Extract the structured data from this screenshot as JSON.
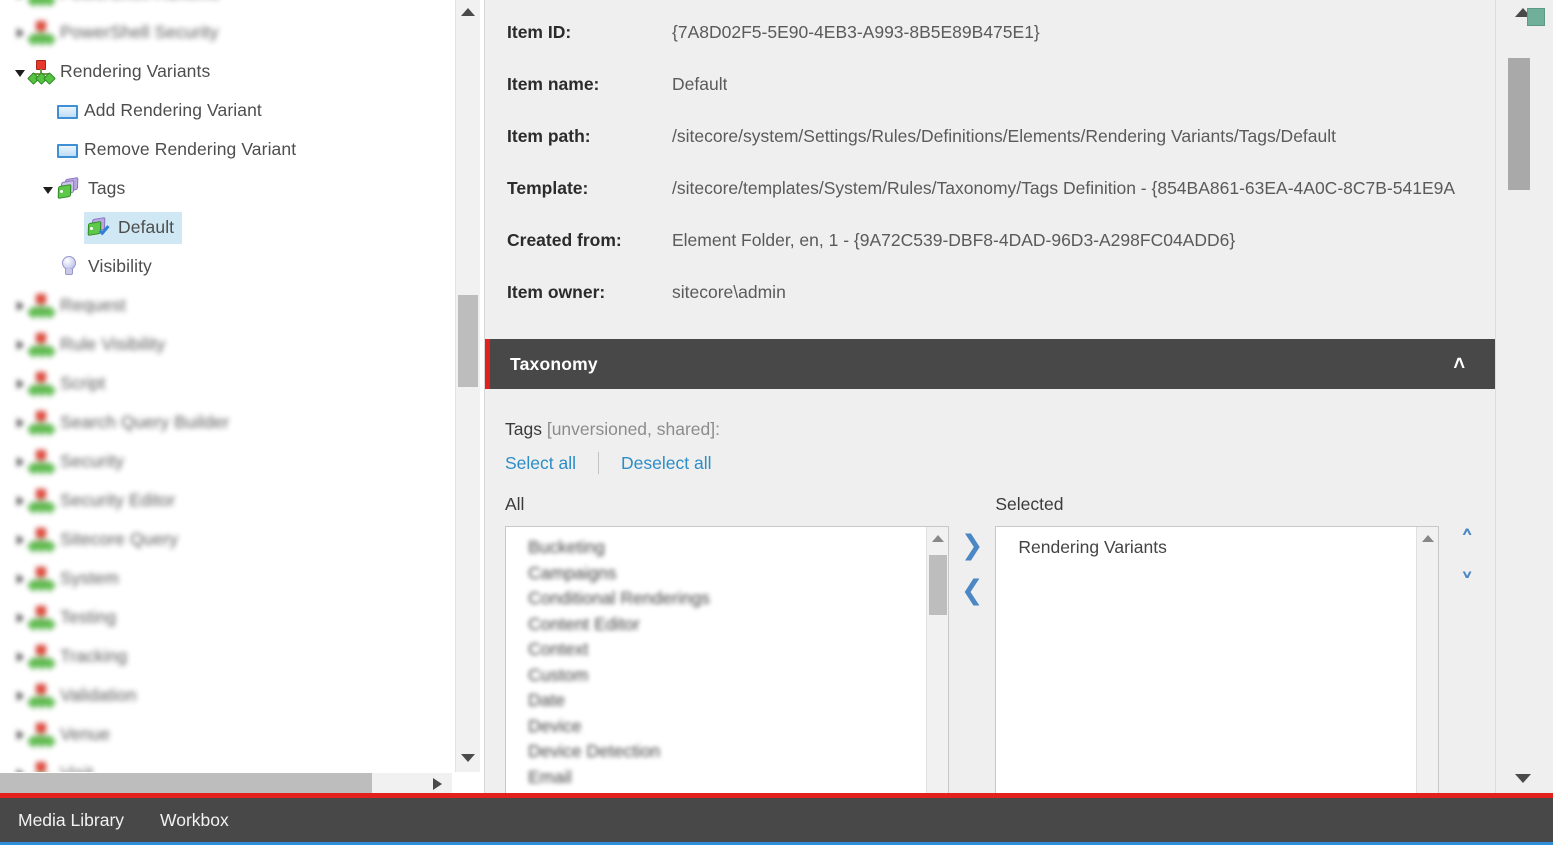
{
  "tree": {
    "items": [
      {
        "label": "PowerShell Runtime",
        "icon": "rules-element-icon",
        "indent": 0,
        "expander": "collapsed",
        "blurred": true,
        "clipped": true
      },
      {
        "label": "PowerShell Security",
        "icon": "rules-element-icon",
        "indent": 0,
        "expander": "collapsed",
        "blurred": true
      },
      {
        "label": "Rendering Variants",
        "icon": "rules-element-icon",
        "indent": 0,
        "expander": "expanded",
        "blurred": false
      },
      {
        "label": "Add Rendering Variant",
        "icon": "blue-rectangle-icon",
        "indent": 1,
        "expander": "none",
        "blurred": false
      },
      {
        "label": "Remove Rendering Variant",
        "icon": "blue-rectangle-icon",
        "indent": 1,
        "expander": "none",
        "blurred": false
      },
      {
        "label": "Tags",
        "icon": "tags-icon",
        "indent": 1,
        "expander": "expanded",
        "blurred": false
      },
      {
        "label": "Default",
        "icon": "tag-check-icon",
        "indent": 2,
        "expander": "none",
        "blurred": false,
        "selected": true
      },
      {
        "label": "Visibility",
        "icon": "lightbulb-icon",
        "indent": 1,
        "expander": "none",
        "blurred": false
      },
      {
        "label": "Request",
        "icon": "rules-element-icon",
        "indent": 0,
        "expander": "collapsed",
        "blurred": true
      },
      {
        "label": "Rule Visibility",
        "icon": "rules-element-icon",
        "indent": 0,
        "expander": "collapsed",
        "blurred": true
      },
      {
        "label": "Script",
        "icon": "rules-element-icon",
        "indent": 0,
        "expander": "collapsed",
        "blurred": true
      },
      {
        "label": "Search Query Builder",
        "icon": "rules-element-icon",
        "indent": 0,
        "expander": "collapsed",
        "blurred": true
      },
      {
        "label": "Security",
        "icon": "rules-element-icon",
        "indent": 0,
        "expander": "collapsed",
        "blurred": true
      },
      {
        "label": "Security Editor",
        "icon": "rules-element-icon",
        "indent": 0,
        "expander": "collapsed",
        "blurred": true
      },
      {
        "label": "Sitecore Query",
        "icon": "rules-element-icon",
        "indent": 0,
        "expander": "collapsed",
        "blurred": true
      },
      {
        "label": "System",
        "icon": "rules-element-icon",
        "indent": 0,
        "expander": "collapsed",
        "blurred": true
      },
      {
        "label": "Testing",
        "icon": "rules-element-icon",
        "indent": 0,
        "expander": "collapsed",
        "blurred": true
      },
      {
        "label": "Tracking",
        "icon": "rules-element-icon",
        "indent": 0,
        "expander": "collapsed",
        "blurred": true
      },
      {
        "label": "Validation",
        "icon": "rules-element-icon",
        "indent": 0,
        "expander": "collapsed",
        "blurred": true
      },
      {
        "label": "Venue",
        "icon": "rules-element-icon",
        "indent": 0,
        "expander": "collapsed",
        "blurred": true
      },
      {
        "label": "Visit",
        "icon": "rules-element-icon",
        "indent": 0,
        "expander": "collapsed",
        "blurred": true,
        "clipped": true
      }
    ]
  },
  "item_info": {
    "rows": [
      {
        "label": "Item ID:",
        "value": "{7A8D02F5-5E90-4EB3-A993-8B5E89B475E1}"
      },
      {
        "label": "Item name:",
        "value": "Default"
      },
      {
        "label": "Item path:",
        "value": "/sitecore/system/Settings/Rules/Definitions/Elements/Rendering Variants/Tags/Default"
      },
      {
        "label": "Template:",
        "value": "/sitecore/templates/System/Rules/Taxonomy/Tags Definition - {854BA861-63EA-4A0C-8C7B-541E9A"
      },
      {
        "label": "Created from:",
        "value": "Element Folder, en, 1 - {9A72C539-DBF8-4DAD-96D3-A298FC04ADD6}"
      },
      {
        "label": "Item owner:",
        "value": "sitecore\\admin"
      }
    ]
  },
  "taxonomy": {
    "title": "Taxonomy",
    "collapse_chevron": "˄",
    "field_label_main": "Tags",
    "field_label_meta": " [unversioned, shared]:",
    "select_all_label": "Select all",
    "deselect_all_label": "Deselect all",
    "all_caption": "All",
    "selected_caption": "Selected",
    "all_items": [
      "Bucketing",
      "Campaigns",
      "Conditional Renderings",
      "Content Editor",
      "Context",
      "Custom",
      "Date",
      "Device",
      "Device Detection",
      "Email"
    ],
    "selected_items": [
      "Rendering Variants"
    ],
    "move_right_glyph": "❯",
    "move_left_glyph": "❮",
    "move_up_glyph": "˄",
    "move_down_glyph": "˅"
  },
  "bottom_bar": {
    "tabs": [
      {
        "label": "Media Library"
      },
      {
        "label": "Workbox"
      }
    ]
  },
  "colors": {
    "accent_red": "#e3211c",
    "header_dark": "#484848",
    "link_blue": "#2c8dc7",
    "arrow_blue": "#4a87c4",
    "selection_blue": "#cfe8f4",
    "indicator_green": "#70b09b",
    "bottom_blue": "#2f8fd8"
  }
}
